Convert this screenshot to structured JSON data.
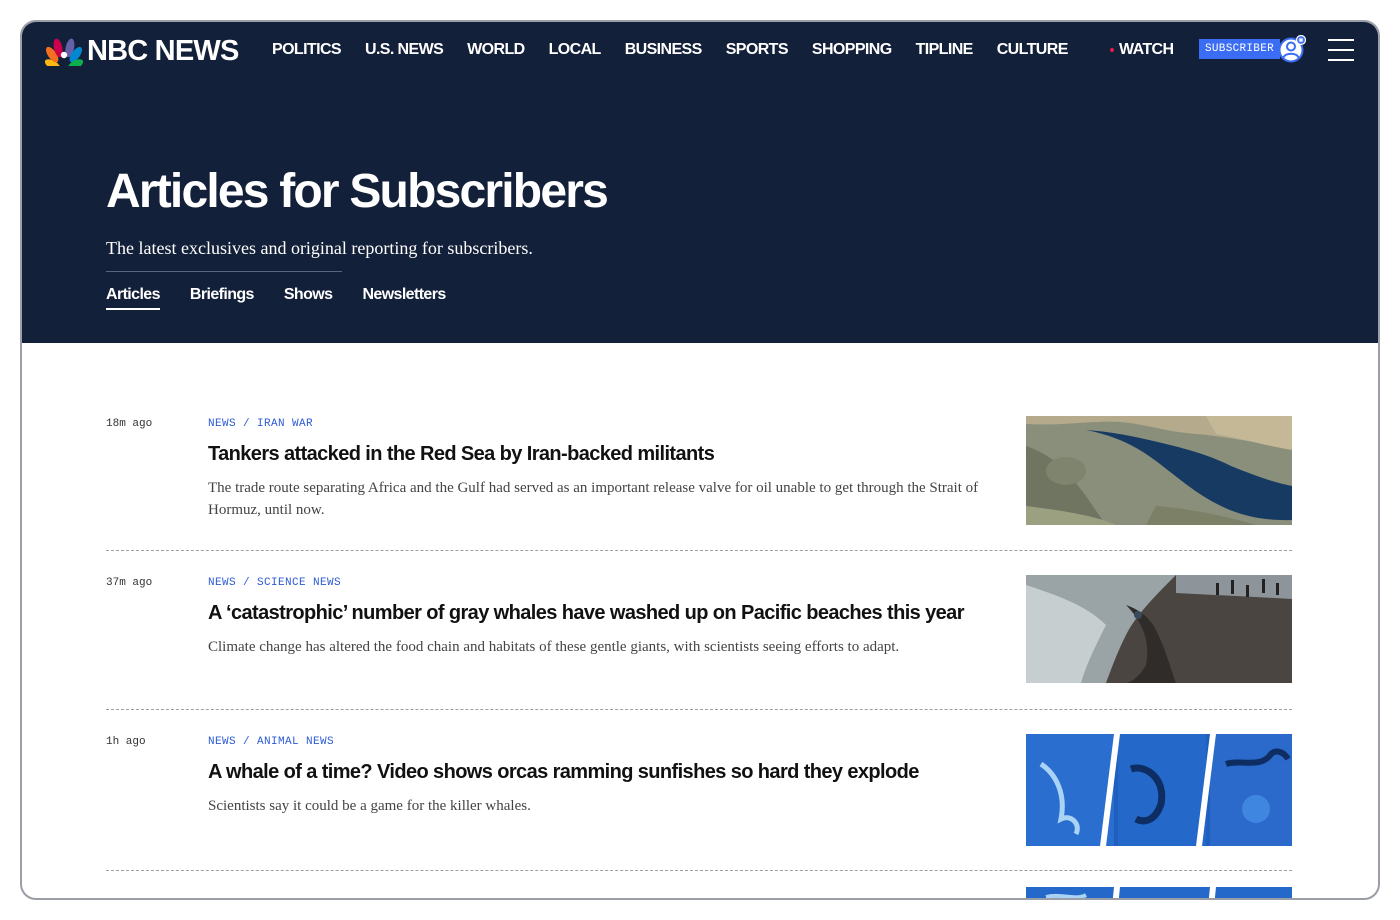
{
  "site": {
    "logo_text": "NBC NEWS"
  },
  "nav": {
    "items": [
      "POLITICS",
      "U.S. NEWS",
      "WORLD",
      "LOCAL",
      "BUSINESS",
      "SPORTS",
      "SHOPPING",
      "TIPLINE",
      "CULTURE"
    ],
    "watch_label": "WATCH",
    "subscriber_label": "SUBSCRIBER"
  },
  "page": {
    "title": "Articles for Subscribers",
    "subtitle": "The latest exclusives and original reporting for subscribers.",
    "tabs": [
      {
        "label": "Articles",
        "active": true
      },
      {
        "label": "Briefings",
        "active": false
      },
      {
        "label": "Shows",
        "active": false
      },
      {
        "label": "Newsletters",
        "active": false
      }
    ]
  },
  "articles": [
    {
      "time": "18m ago",
      "eyebrow": "NEWS / IRAN WAR",
      "headline": "Tankers attacked in the Red Sea by Iran-backed militants",
      "dek": "The trade route separating Africa and the Gulf had served as an important release valve for oil unable to get through the Strait of Hormuz, until now."
    },
    {
      "time": "37m ago",
      "eyebrow": "NEWS / SCIENCE NEWS",
      "headline": "A ‘catastrophic’ number of gray whales have washed up on Pacific beaches this year",
      "dek": "Climate change has altered the food chain and habitats of these gentle giants, with scientists seeing efforts to adapt."
    },
    {
      "time": "1h ago",
      "eyebrow": "NEWS / ANIMAL NEWS",
      "headline": "A whale of a time? Video shows orcas ramming sunfishes so hard they explode",
      "dek": "Scientists say it could be a game for the killer whales."
    }
  ],
  "colors": {
    "hero_bg": "#132039",
    "accent": "#2d5bd6",
    "subscriber_badge": "#3a6cf4"
  },
  "icons": [
    "peacock-logo-icon",
    "live-dot-icon",
    "user-avatar-icon",
    "hamburger-menu-icon"
  ]
}
